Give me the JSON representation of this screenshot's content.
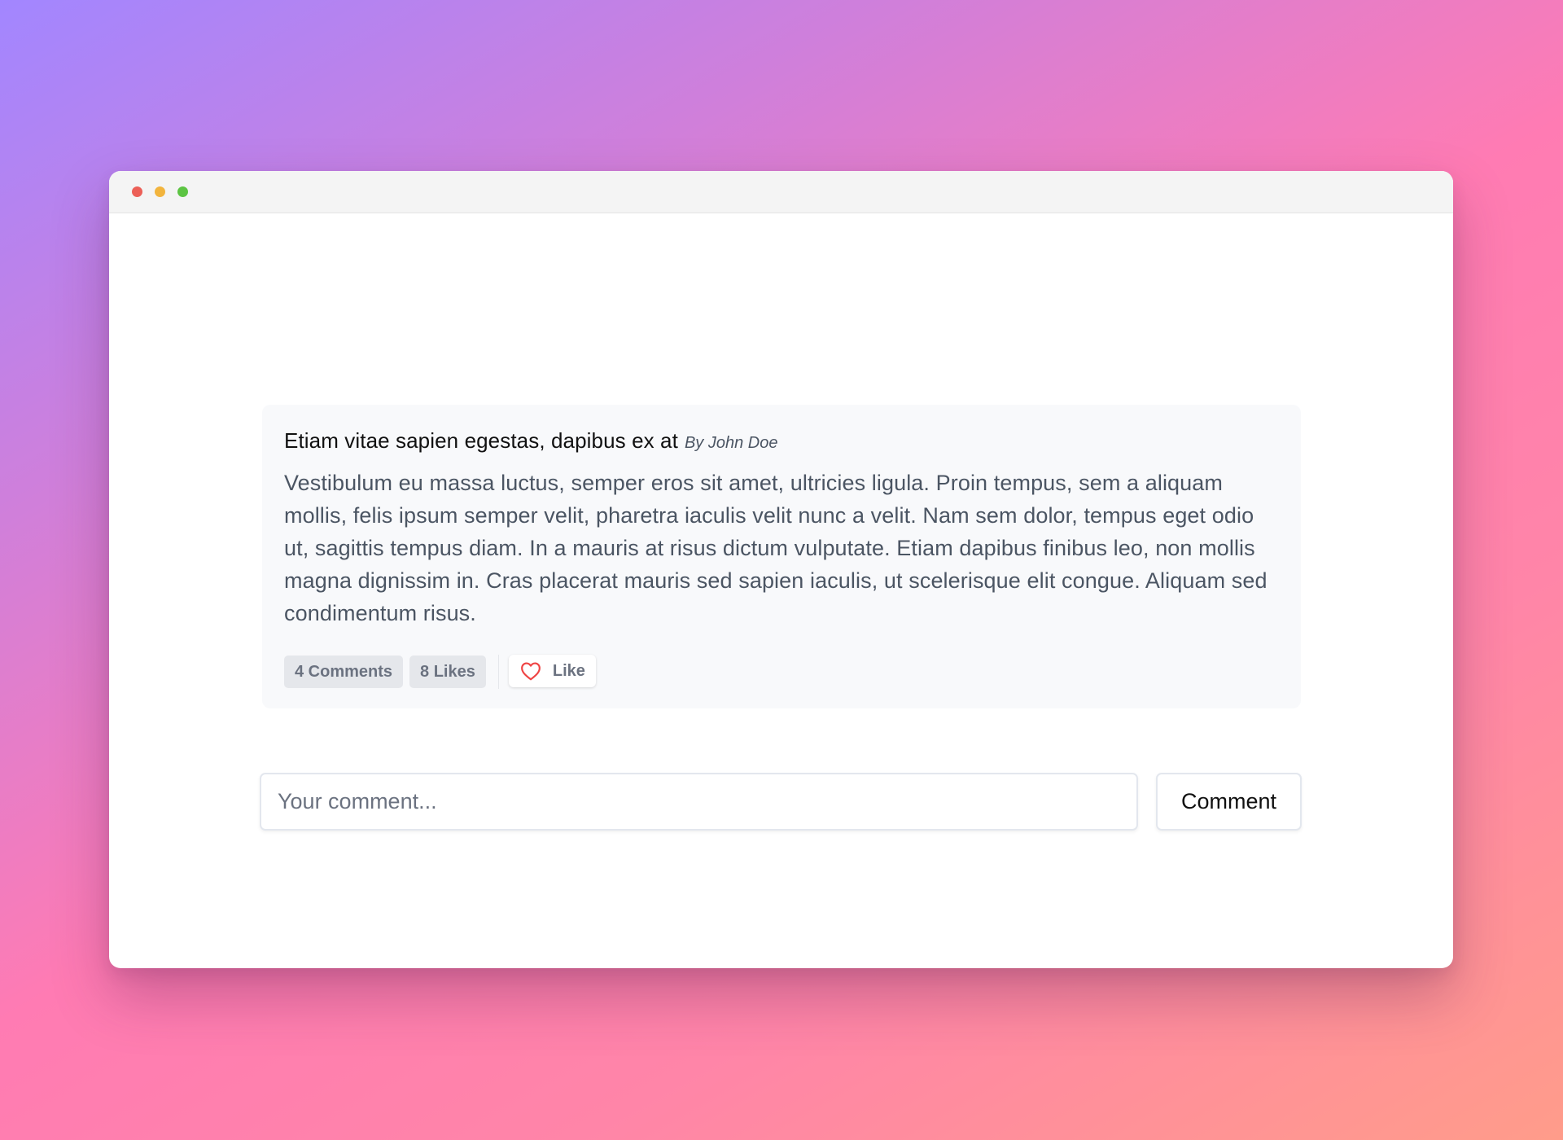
{
  "window": {
    "controls": [
      "close",
      "minimize",
      "maximize"
    ]
  },
  "post": {
    "title": "Etiam vitae sapien egestas, dapibus ex at",
    "author": "By John Doe",
    "body": "Vestibulum eu massa luctus, semper eros sit amet, ultricies ligula. Proin tempus, sem a aliquam mollis, felis ipsum semper velit, pharetra iaculis velit nunc a velit. Nam sem dolor, tempus eget odio ut, sagittis tempus diam. In a mauris at risus dictum vulputate. Etiam dapibus finibus leo, non mollis magna dignissim in. Cras placerat mauris sed sapien iaculis, ut scelerisque elit congue. Aliquam sed condimentum risus.",
    "comments_badge": "4 Comments",
    "likes_badge": "8 Likes",
    "like_button_label": "Like",
    "like_icon": "heart-outline-icon"
  },
  "comment_form": {
    "placeholder": "Your comment...",
    "value": "",
    "submit_label": "Comment"
  },
  "colors": {
    "close": "#ec5f57",
    "minimize": "#f2b43d",
    "maximize": "#5cc443",
    "heart": "#ef4444"
  }
}
